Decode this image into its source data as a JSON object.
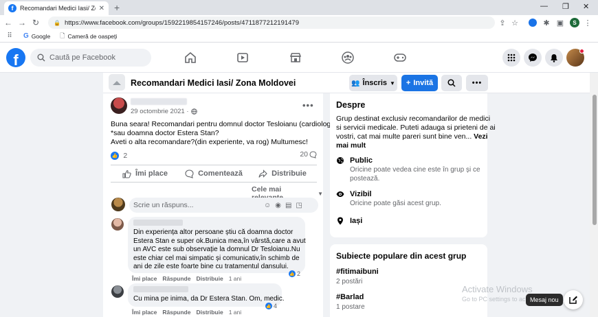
{
  "browser": {
    "tab_title": "Recomandari Medici Iasi/ Zona M",
    "url": "https://www.facebook.com/groups/1592219854157246/posts/4711877212191479",
    "profile_initial": "S",
    "bookmarks": [
      {
        "label": "Google",
        "icon": "google-icon"
      },
      {
        "label": "Cameră de oaspeți",
        "icon": "bookmark-icon"
      }
    ]
  },
  "facebook": {
    "logo": "f",
    "search_placeholder": "Caută pe Facebook",
    "brand_color": "#1877f2"
  },
  "group": {
    "name": "Recomandari Medici Iasi/ Zona Moldovei",
    "join_label": "Înscris",
    "invite_label": "Invită"
  },
  "post": {
    "date": "29 octombrie 2021 ·",
    "text_lines": [
      "Buna seara! Recomandari pentru domnul doctor Tesloianu (cardiolog)?",
      "*sau doamna doctor Estera Stan?",
      "Aveti o alta recomandare?(din experiente, va rog) Multumesc!"
    ],
    "reactions_count": "2",
    "comments_count": "20",
    "actions": {
      "like": "Îmi place",
      "comment": "Comentează",
      "share": "Distribuie"
    },
    "sort_label": "Cele mai relevante",
    "reply_placeholder": "Scrie un răspuns..."
  },
  "comments": [
    {
      "text_lines": [
        "Din experiența altor persoane știu că doamna doctor",
        "Estera Stan e super ok.Bunica mea,în vârstă,care a avut",
        "un AVC este sub observație la domnul Dr Tesloianu.Nu",
        "este chiar cel mai simpatic și comunicativ,în schimb de",
        "ani de zile este foarte bine cu tratamentul dansului."
      ],
      "like": "Îmi place",
      "reply": "Răspunde",
      "share": "Distribuie",
      "age": "1 ani",
      "reactions": "2"
    },
    {
      "text_lines": [
        "Cu mina pe inima, da Dr Estera Stan. Om, medic."
      ],
      "like": "Îmi place",
      "reply": "Răspunde",
      "share": "Distribuie",
      "age": "1 ani",
      "reactions": "4"
    }
  ],
  "about": {
    "title": "Despre",
    "desc_lines": [
      "Grup destinat exclusiv recomandarilor de medici",
      "si servicii medicale. Puteti adauga si prieteni de ai",
      "vostri, cat mai multe pareri sunt bine ven..."
    ],
    "see_more_a": "Vezi",
    "see_more_b": "mai mult",
    "public_title": "Public",
    "public_desc_lines": [
      "Oricine poate vedea cine este în grup și ce",
      "postează."
    ],
    "visible_title": "Vizibil",
    "visible_desc": "Oricine poate găsi acest grup.",
    "location": "Iași"
  },
  "topics": {
    "title": "Subiecte populare din acest grup",
    "items": [
      {
        "tag": "#fitimaibuni",
        "count": "2 postări"
      },
      {
        "tag": "#Barlad",
        "count": "1 postare"
      }
    ]
  },
  "overlay": {
    "activate_line1": "Activate Windows",
    "activate_line2": "Go to PC settings to activate Windows.",
    "new_message": "Mesaj nou"
  }
}
